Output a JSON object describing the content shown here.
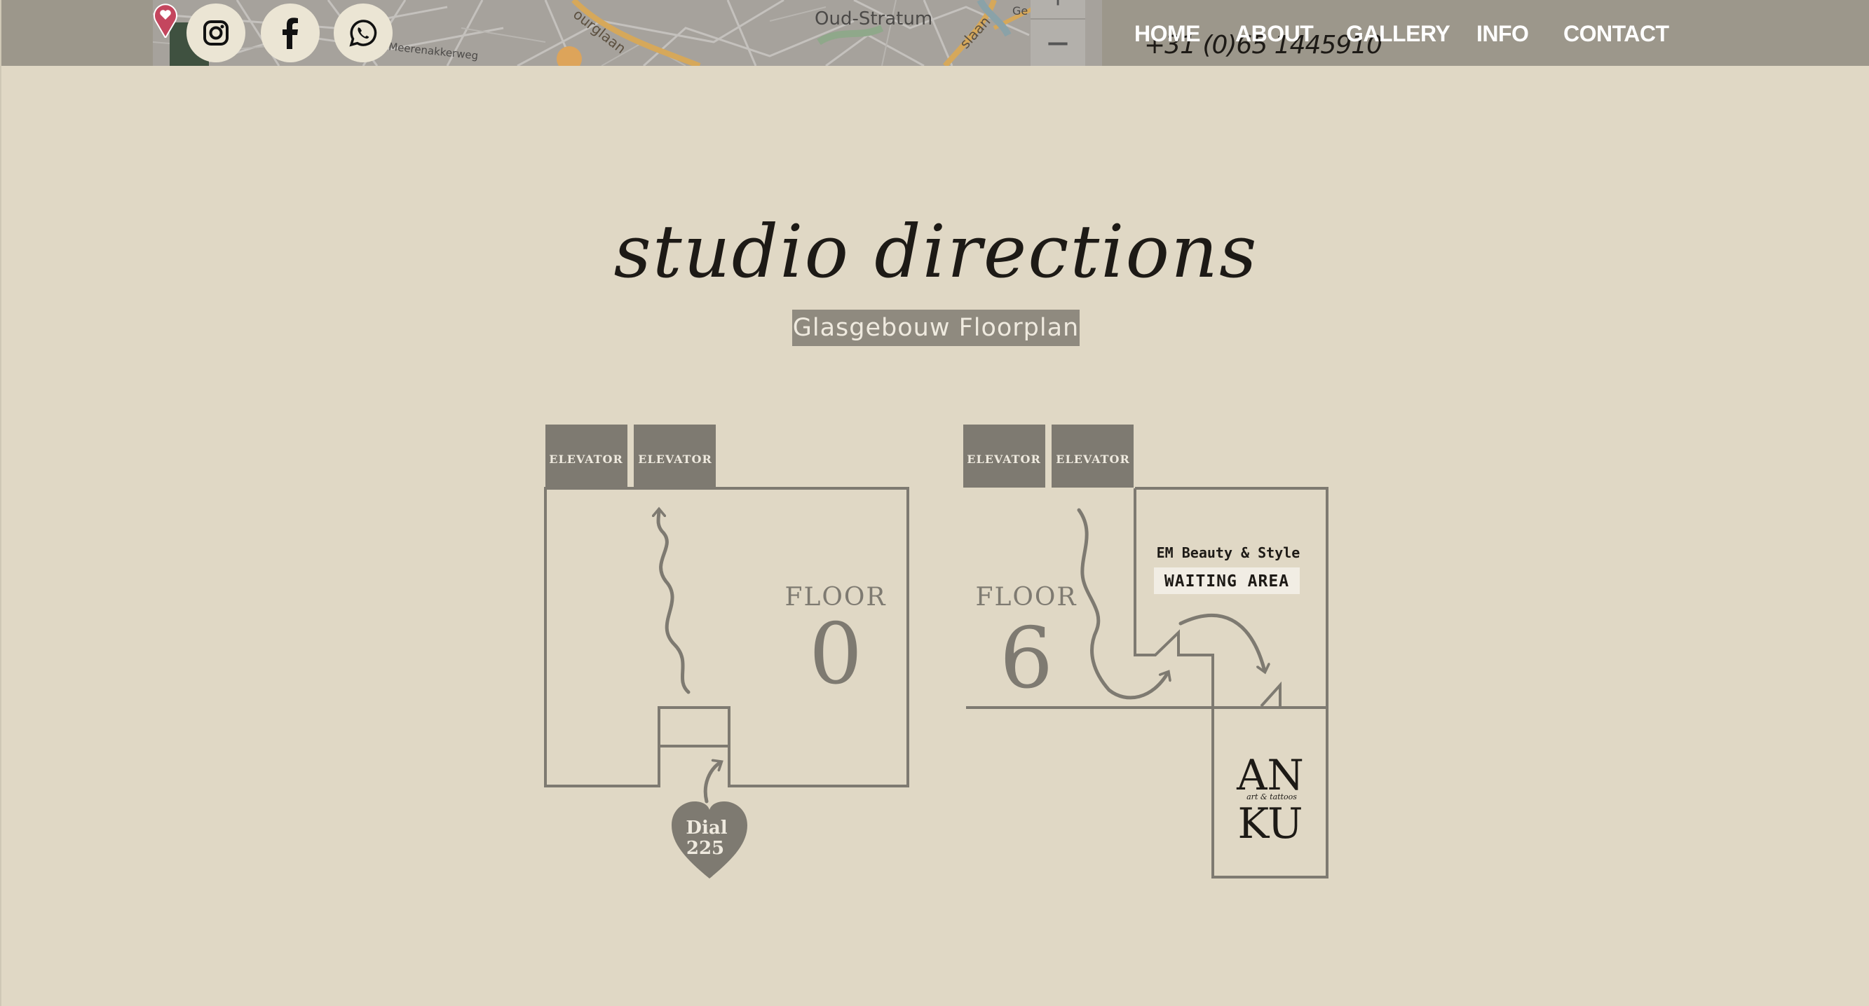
{
  "header": {
    "map": {
      "city": "Oud-Stratum",
      "street_1": "ourglaan",
      "street_2": "Meerenakkerweg",
      "street_3": "slaan",
      "street_4": "Ge",
      "zoom_in": "+",
      "zoom_out": "−"
    },
    "social": {
      "instagram": "instagram-icon",
      "facebook": "facebook-icon",
      "whatsapp": "whatsapp-icon"
    },
    "phone": "+31 (0)65 1445910",
    "nav": [
      "HOME",
      "ABOUT",
      "GALLERY",
      "INFO",
      "CONTACT"
    ]
  },
  "main": {
    "title": "studio directions",
    "subtitle": "Glasgebouw Floorplan"
  },
  "floorplan": {
    "floor0": {
      "elevators": [
        "ELEVATOR",
        "ELEVATOR"
      ],
      "label": "FLOOR",
      "number": "0",
      "dial": [
        "Dial",
        "225"
      ]
    },
    "floor6": {
      "elevators": [
        "ELEVATOR",
        "ELEVATOR"
      ],
      "label": "FLOOR",
      "number": "6",
      "waiting_title": "EM Beauty & Style",
      "waiting_area": "WAITING AREA",
      "logo_top": "AN",
      "logo_tag": "art & tattoos",
      "logo_bottom": "KU"
    }
  },
  "colors": {
    "background": "#e0d8c5",
    "header": "#9c978b",
    "plan_stroke": "#7e7a71",
    "text_dark": "#1d1a16"
  }
}
